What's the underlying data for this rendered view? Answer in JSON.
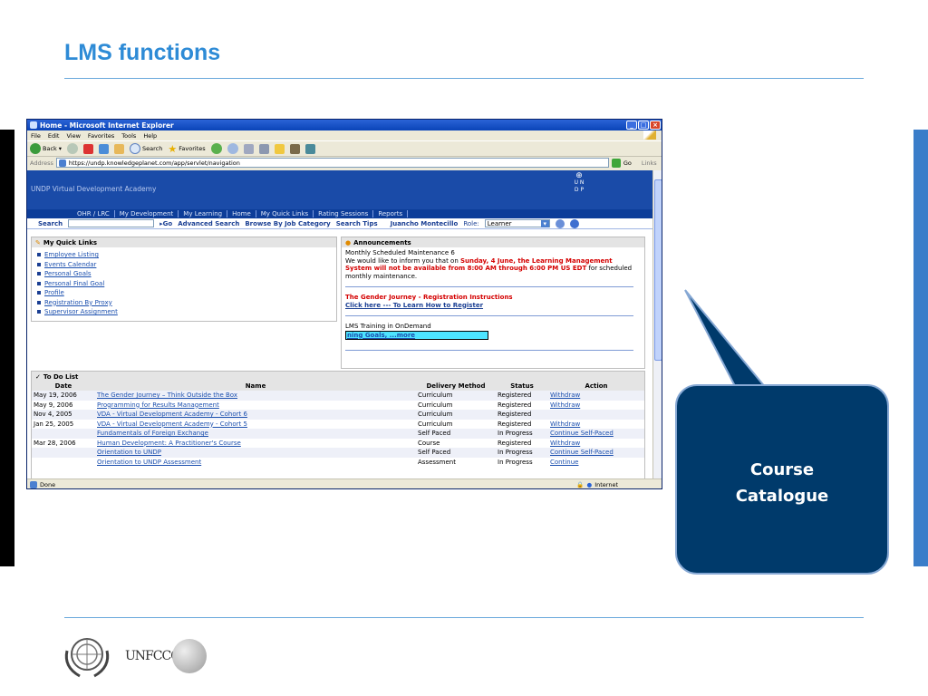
{
  "slide": {
    "title": "LMS functions",
    "callout_text": [
      "Course",
      "Catalogue"
    ],
    "logo_text": "UNFCCC"
  },
  "window": {
    "title": "Home - Microsoft Internet Explorer",
    "menu": [
      "File",
      "Edit",
      "View",
      "Favorites",
      "Tools",
      "Help"
    ],
    "toolbar": {
      "back": "Back",
      "search": "Search",
      "favorites": "Favorites"
    },
    "address_label": "Address",
    "url": "https://undp.knowledgeplanet.com/app/servlet/navigation",
    "go": "Go",
    "links": "Links",
    "status_left": "Done",
    "status_right": "Internet"
  },
  "portal": {
    "academy": "UNDP Virtual Development Academy",
    "un_logo": [
      "U",
      "N",
      "D",
      "P"
    ],
    "nav": [
      "OHR / LRC",
      "My Development",
      "My Learning",
      "Home",
      "My Quick Links",
      "Rating Sessions",
      "Reports"
    ],
    "search_label": "Search",
    "go": "Go",
    "advanced_search": "Advanced Search",
    "browse": "Browse By Job Category",
    "search_tips": "Search Tips",
    "user": "Juancho Montecillo",
    "role_label": "Role:",
    "role_value": "Learner"
  },
  "quick_links": {
    "title": "My Quick Links",
    "items": [
      "Employee Listing",
      "Events Calendar",
      "Personal Goals",
      "Personal Final Goal",
      "Profile",
      "Registration By Proxy",
      "Supervisor Assignment"
    ]
  },
  "announcements": {
    "title": "Announcements",
    "item1_title": "Monthly Scheduled Maintenance 6",
    "item1_pre": "We would like to inform you that on ",
    "item1_red": "Sunday, 4 June, the Learning Management System will not be available from 8:00 AM through 6:00 PM US EDT",
    "item1_post": " for scheduled monthly maintenance.",
    "item2_title": "The Gender Journey - Registration Instructions",
    "item2_link": "Click here --- To Learn How to Register",
    "item3_title": "LMS Training in OnDemand",
    "item3_link": "ning Goals, ...more"
  },
  "todo": {
    "title": "To Do List",
    "headers": [
      "Date",
      "Name",
      "Delivery Method",
      "Status",
      "Action"
    ],
    "rows": [
      {
        "date": "May 19, 2006",
        "name": "The Gender Journey – Think Outside the Box",
        "method": "Curriculum",
        "status": "Registered",
        "action": "Withdraw"
      },
      {
        "date": "May 9, 2006",
        "name": "Programming for Results Management",
        "method": "Curriculum",
        "status": "Registered",
        "action": "Withdraw"
      },
      {
        "date": "Nov 4, 2005",
        "name": "VDA - Virtual Development Academy - Cohort 6",
        "method": "Curriculum",
        "status": "Registered",
        "action": ""
      },
      {
        "date": "Jan 25, 2005",
        "name": "VDA - Virtual Development Academy - Cohort 5",
        "method": "Curriculum",
        "status": "Registered",
        "action": "Withdraw"
      },
      {
        "date": "",
        "name": "Fundamentals of Foreign Exchange",
        "method": "Self Paced",
        "status": "In Progress",
        "action": "Continue Self-Paced"
      },
      {
        "date": "Mar 28, 2006",
        "name": "Human Development: A Practitioner's Course",
        "method": "Course",
        "status": "Registered",
        "action": "Withdraw"
      },
      {
        "date": "",
        "name": "Orientation to UNDP",
        "method": "Self Paced",
        "status": "In Progress",
        "action": "Continue Self-Paced"
      },
      {
        "date": "",
        "name": "Orientation to UNDP Assessment",
        "method": "Assessment",
        "status": "In Progress",
        "action": "Continue"
      }
    ]
  }
}
